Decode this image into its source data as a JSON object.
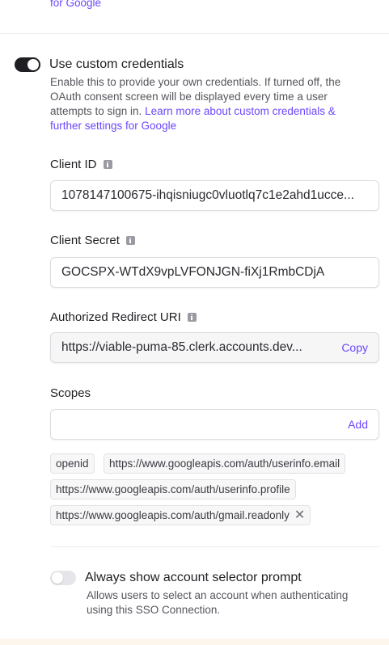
{
  "header": {
    "link_tail": "for Google"
  },
  "custom_credentials": {
    "enabled": true,
    "title": "Use custom credentials",
    "description": "Enable this to provide your own credentials. If turned off, the OAuth consent screen will be displayed every time a user attempts to sign in.",
    "link": "Learn more about custom credentials & further settings for Google"
  },
  "client_id": {
    "label": "Client ID",
    "value": "1078147100675-ihqisniugc0vluotlq7c1e2ahd1ucce..."
  },
  "client_secret": {
    "label": "Client Secret",
    "value": "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"
  },
  "redirect_uri": {
    "label": "Authorized Redirect URI",
    "value": "https://viable-puma-85.clerk.accounts.dev...",
    "action": "Copy"
  },
  "scopes": {
    "label": "Scopes",
    "input_value": "",
    "action": "Add",
    "chips": [
      "openid",
      "https://www.googleapis.com/auth/userinfo.email",
      "https://www.googleapis.com/auth/userinfo.profile",
      "https://www.googleapis.com/auth/gmail.readonly"
    ]
  },
  "account_selector": {
    "enabled": false,
    "title": "Always show account selector prompt",
    "description": "Allows users to select an account when authenticating using this SSO Connection."
  },
  "colors": {
    "accent": "#6c47ff",
    "text": "#1f1f23",
    "muted": "#55555c"
  }
}
